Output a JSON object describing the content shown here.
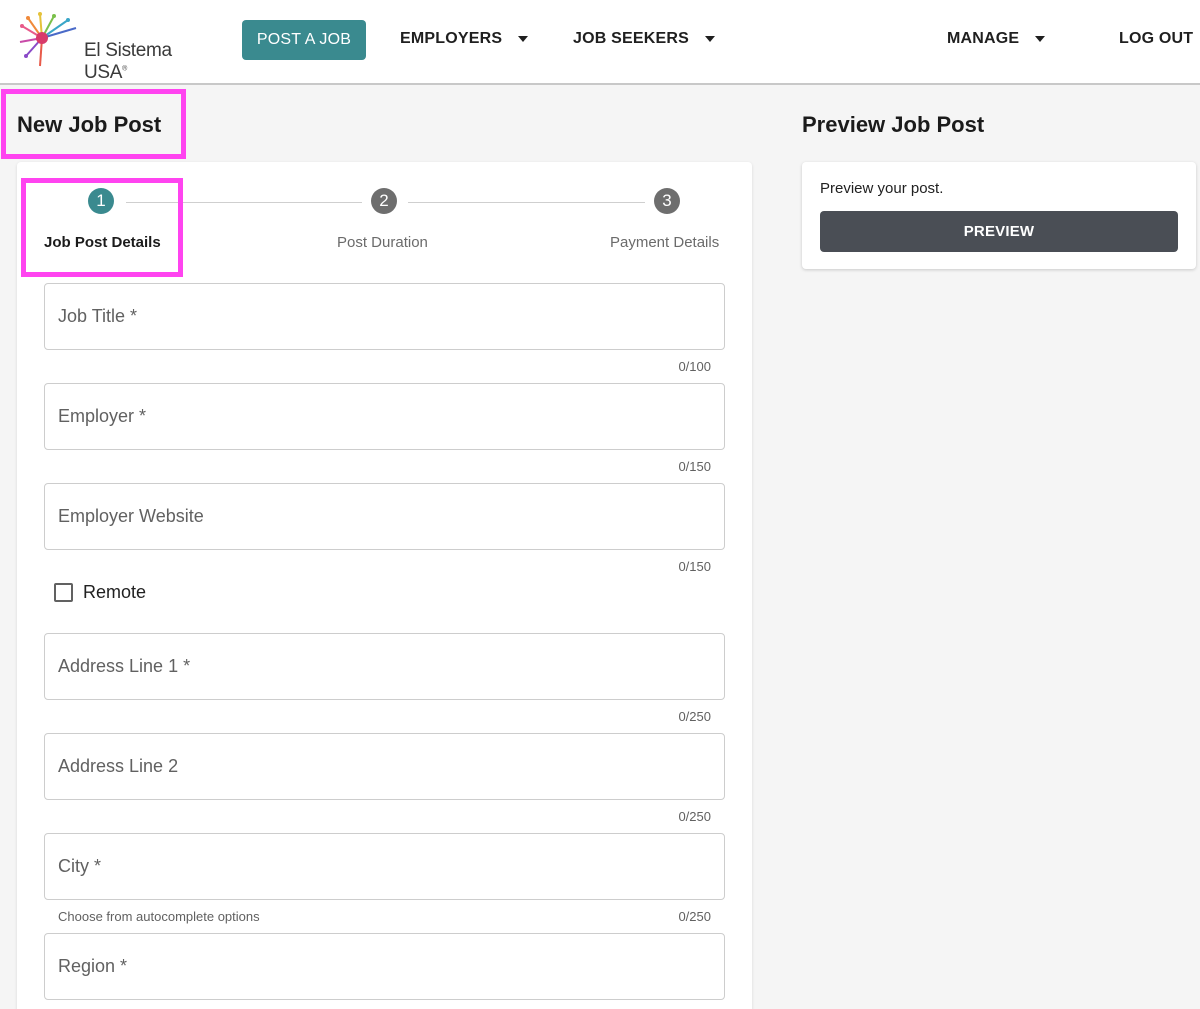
{
  "brand": {
    "name": "El Sistema USA",
    "reg": "®"
  },
  "header": {
    "post_job": "POST A JOB",
    "employers": "EMPLOYERS",
    "job_seekers": "JOB SEEKERS",
    "manage": "MANAGE",
    "logout": "LOG OUT"
  },
  "page": {
    "title": "New Job Post",
    "preview_title": "Preview Job Post"
  },
  "stepper": {
    "steps": [
      {
        "num": "1",
        "label": "Job Post Details",
        "active": true
      },
      {
        "num": "2",
        "label": "Post Duration",
        "active": false
      },
      {
        "num": "3",
        "label": "Payment Details",
        "active": false
      }
    ]
  },
  "form": {
    "fields": [
      {
        "placeholder": "Job Title *",
        "value": "",
        "counter": "0/100"
      },
      {
        "placeholder": "Employer *",
        "value": "",
        "counter": "0/150"
      },
      {
        "placeholder": "Employer Website",
        "value": "",
        "counter": "0/150"
      },
      {
        "placeholder": "Address Line 1 *",
        "value": "",
        "counter": "0/250"
      },
      {
        "placeholder": "Address Line 2",
        "value": "",
        "counter": "0/250"
      },
      {
        "placeholder": "City *",
        "value": "",
        "counter": "0/250",
        "helper": "Choose from autocomplete options"
      },
      {
        "placeholder": "Region *",
        "value": ""
      }
    ],
    "remote_label": "Remote",
    "remote_checked": false
  },
  "preview": {
    "text": "Preview your post.",
    "button": "PREVIEW"
  },
  "colors": {
    "accent": "#3a8a8f",
    "highlight": "#ff44f0",
    "preview_button": "#4a4e55"
  }
}
